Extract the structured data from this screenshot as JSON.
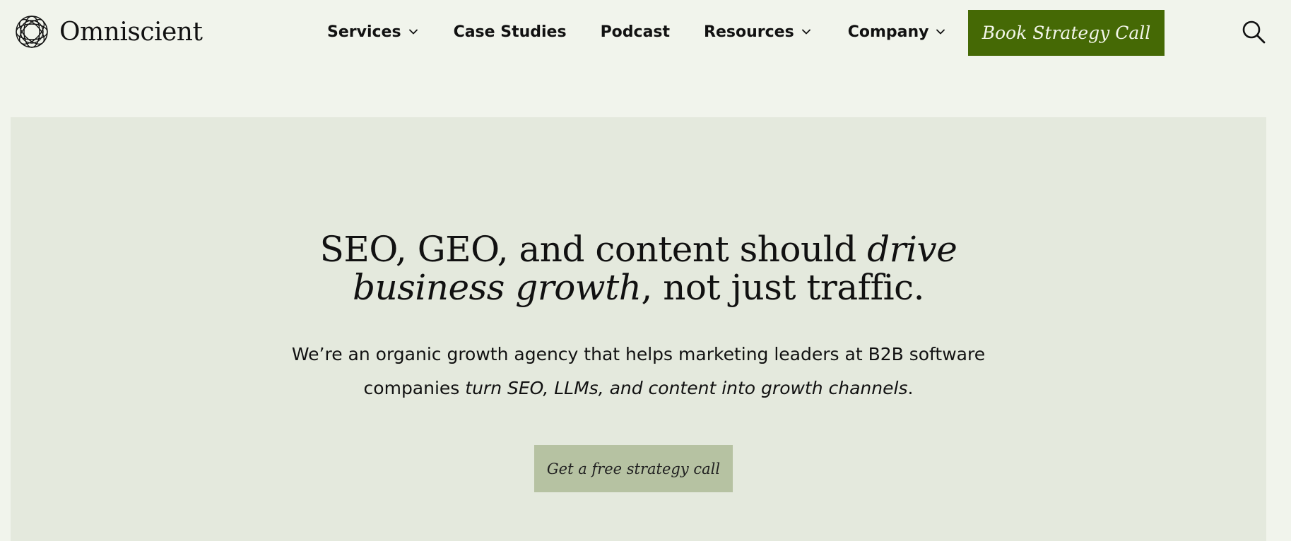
{
  "header": {
    "logo_text": "Omniscient",
    "logo_icon": "knot-logo-icon",
    "nav": [
      {
        "label": "Services",
        "has_dropdown": true
      },
      {
        "label": "Case Studies",
        "has_dropdown": false
      },
      {
        "label": "Podcast",
        "has_dropdown": false
      },
      {
        "label": "Resources",
        "has_dropdown": true
      },
      {
        "label": "Company",
        "has_dropdown": true
      }
    ],
    "cta_label": "Book Strategy Call",
    "search_icon": "search-icon"
  },
  "hero": {
    "headline_part1": "SEO, GEO, and content should ",
    "headline_em1": "drive",
    "headline_em2": "business growth",
    "headline_part2": ", not just traffic.",
    "subhead_part1": "We’re an organic growth agency that helps marketing leaders at B2B software",
    "subhead_part2": "companies ",
    "subhead_em": "turn SEO, LLMs, and content into growth channels",
    "subhead_part3": ".",
    "cta_label": "Get a free strategy call"
  },
  "colors": {
    "page_bg": "#f1f4ec",
    "hero_bg": "#e4e9dd",
    "primary_cta": "#456905",
    "secondary_cta": "#b6c2a2"
  }
}
